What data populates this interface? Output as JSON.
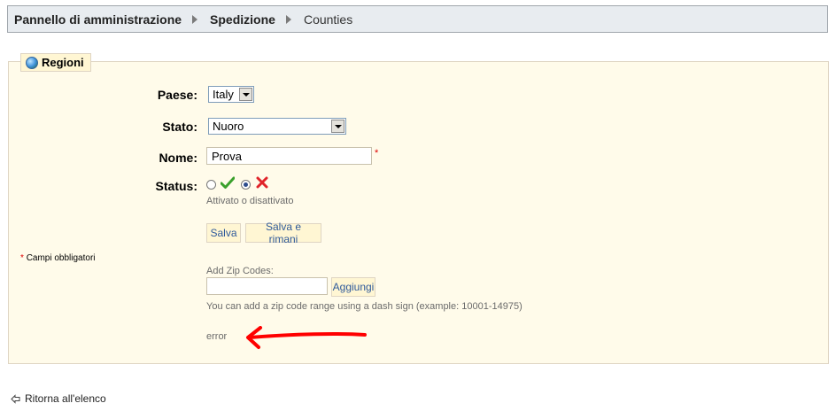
{
  "breadcrumb": {
    "items": [
      "Pannello di amministrazione",
      "Spedizione",
      "Counties"
    ]
  },
  "panel": {
    "legend": "Regioni",
    "legend_icon": "globe-icon"
  },
  "form": {
    "country": {
      "label": "Paese:",
      "value": "Italy"
    },
    "state": {
      "label": "Stato:",
      "value": "Nuoro"
    },
    "name": {
      "label": "Nome:",
      "value": "Prova",
      "required_mark": "*"
    },
    "status": {
      "label": "Status:",
      "hint": "Attivato o disattivato",
      "enabled_icon": "check-icon",
      "disabled_icon": "cross-icon",
      "selected": "disabled"
    },
    "save_label": "Salva",
    "save_stay_label": "Salva e rimani",
    "required_note_star": "*",
    "required_note": "Campi obbligatori"
  },
  "zip": {
    "label": "Add Zip Codes:",
    "value": "",
    "add_label": "Aggiungi",
    "help": "You can add a zip code range using a dash sign (example: 10001-14975)",
    "error": "error"
  },
  "back": {
    "label": "Ritorna all'elenco",
    "icon": "back-arrow-icon"
  },
  "colors": {
    "panel_bg": "#fffbea",
    "button_bg": "#fff6d3",
    "button_text": "#2f5a9b",
    "annotation": "#ff0000",
    "check": "#3aa02c",
    "cross": "#e0242a"
  }
}
